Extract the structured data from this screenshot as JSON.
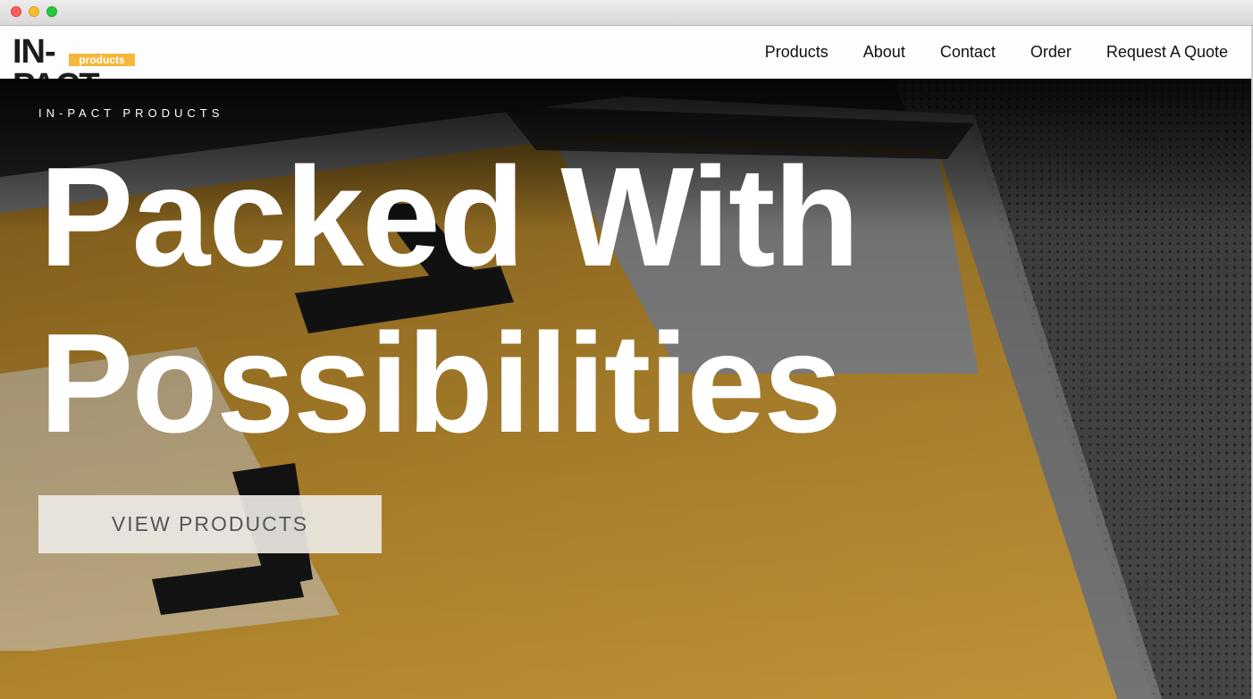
{
  "logo": {
    "main": "IN-PACT",
    "sub": "products"
  },
  "nav": {
    "items": [
      {
        "label": "Products"
      },
      {
        "label": "About"
      },
      {
        "label": "Contact"
      },
      {
        "label": "Order"
      },
      {
        "label": "Request A Quote"
      }
    ]
  },
  "hero": {
    "eyebrow": "IN-PACT PRODUCTS",
    "headline_line1": "Packed With",
    "headline_line2": "Possibilities",
    "cta_label": "VIEW PRODUCTS"
  },
  "colors": {
    "brand_yellow": "#f6b73c",
    "hero_gold": "#c9962e"
  }
}
